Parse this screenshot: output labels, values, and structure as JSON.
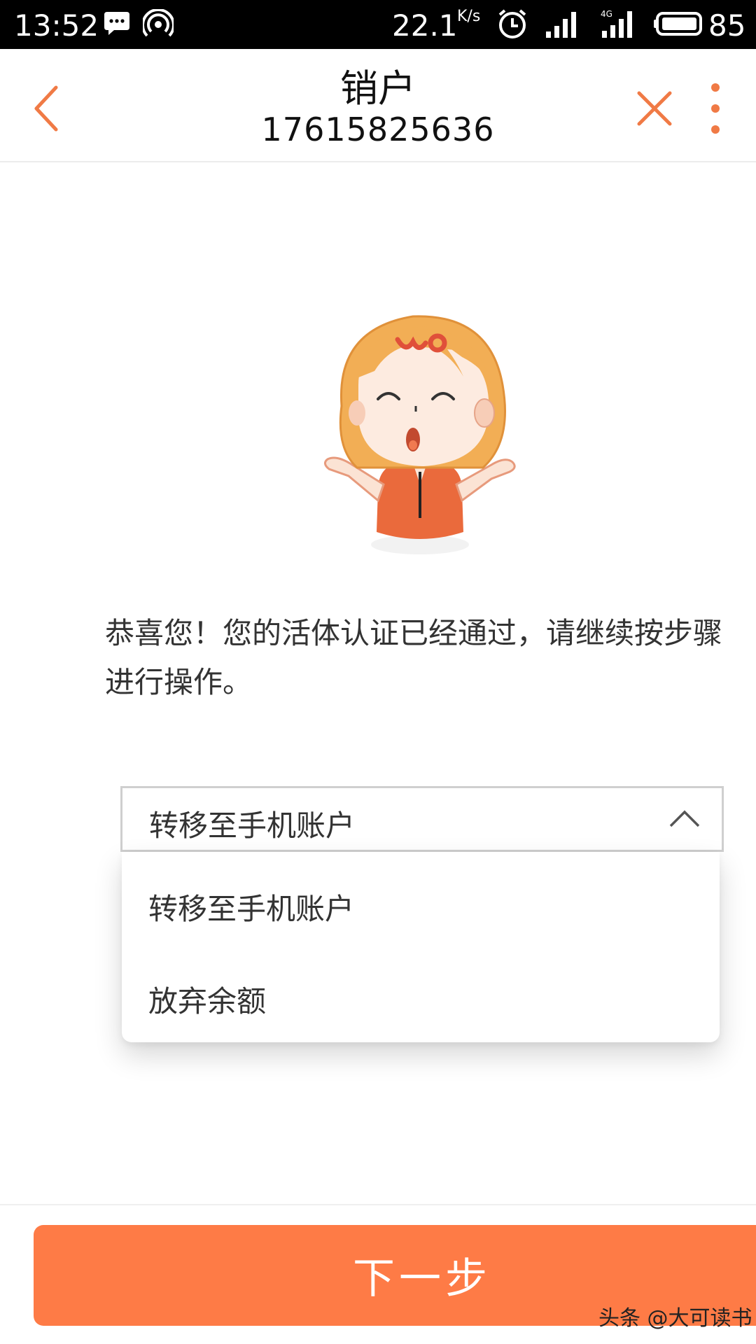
{
  "status_bar": {
    "time": "13:52",
    "net_speed": "22.1",
    "net_speed_unit": "K/s",
    "battery": "85",
    "icons": [
      "chat-icon",
      "hotspot-icon",
      "alarm-icon",
      "signal-icon",
      "4g-signal-icon",
      "battery-icon"
    ]
  },
  "header": {
    "title": "销户",
    "subtitle": "17615825636",
    "icons": [
      "back-icon",
      "close-icon",
      "more-icon"
    ],
    "accent_color": "#f07a45"
  },
  "main": {
    "mascot_logo": "wo",
    "message": "恭喜您！您的活体认证已经通过，请继续按步骤进行操作。"
  },
  "select": {
    "value": "转移至手机账户",
    "options": [
      "转移至手机账户",
      "放弃余额"
    ]
  },
  "footer": {
    "next_label": "下一步",
    "button_color": "#fe7b46"
  },
  "watermark": "头条 @大可读书"
}
